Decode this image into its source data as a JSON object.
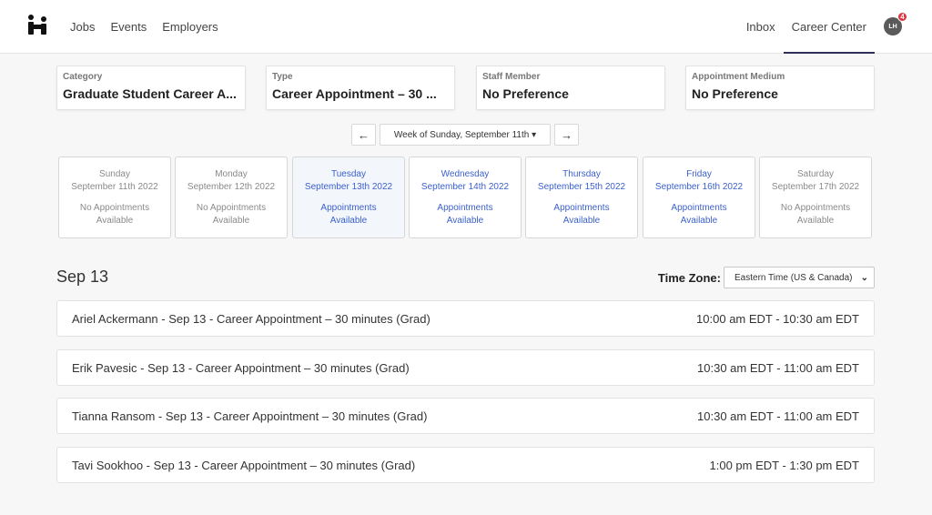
{
  "nav": {
    "logo_icon": "handshake-logo-icon",
    "left_links": [
      "Jobs",
      "Events",
      "Employers"
    ],
    "right_links": [
      "Inbox",
      "Career Center"
    ],
    "active_link": "Career Center",
    "avatar_initials": "LH",
    "notification_count": "4"
  },
  "filters": [
    {
      "label": "Category",
      "value": "Graduate Student Career A..."
    },
    {
      "label": "Type",
      "value": "Career Appointment – 30 ..."
    },
    {
      "label": "Staff Member",
      "value": "No Preference"
    },
    {
      "label": "Appointment Medium",
      "value": "No Preference"
    }
  ],
  "week_nav": {
    "prev_icon": "arrow-left-icon",
    "label": "Week of Sunday, September 11th ▾",
    "next_icon": "arrow-right-icon",
    "prev_glyph": "🡐",
    "next_glyph": "🡒"
  },
  "days": [
    {
      "weekday": "Sunday",
      "date": "September 11th 2022",
      "status1": "No Appointments",
      "status2": "Available",
      "available": false,
      "selected": false
    },
    {
      "weekday": "Monday",
      "date": "September 12th 2022",
      "status1": "No Appointments",
      "status2": "Available",
      "available": false,
      "selected": false
    },
    {
      "weekday": "Tuesday",
      "date": "September 13th 2022",
      "status1": "Appointments",
      "status2": "Available",
      "available": true,
      "selected": true
    },
    {
      "weekday": "Wednesday",
      "date": "September 14th 2022",
      "status1": "Appointments",
      "status2": "Available",
      "available": true,
      "selected": false
    },
    {
      "weekday": "Thursday",
      "date": "September 15th 2022",
      "status1": "Appointments",
      "status2": "Available",
      "available": true,
      "selected": false
    },
    {
      "weekday": "Friday",
      "date": "September 16th 2022",
      "status1": "Appointments",
      "status2": "Available",
      "available": true,
      "selected": false
    },
    {
      "weekday": "Saturday",
      "date": "September 17th 2022",
      "status1": "No Appointments",
      "status2": "Available",
      "available": false,
      "selected": false
    }
  ],
  "schedule": {
    "date_heading": "Sep 13",
    "timezone_label": "Time Zone:",
    "timezone_value": "Eastern Time (US & Canada)",
    "slots": [
      {
        "title": "Ariel Ackermann - Sep 13 - Career Appointment – 30 minutes (Grad)",
        "time": "10:00 am EDT - 10:30 am EDT"
      },
      {
        "title": "Erik Pavesic - Sep 13 - Career Appointment – 30 minutes (Grad)",
        "time": "10:30 am EDT - 11:00 am EDT"
      },
      {
        "title": "Tianna Ransom - Sep 13 - Career Appointment – 30 minutes (Grad)",
        "time": "10:30 am EDT - 11:00 am EDT"
      },
      {
        "title": "Tavi Sookhoo - Sep 13 - Career Appointment – 30 minutes (Grad)",
        "time": "1:00 pm EDT - 1:30 pm EDT"
      }
    ]
  },
  "colors": {
    "accent_blue": "#3a5fcd",
    "active_underline": "#2d2f5a",
    "badge_red": "#e0303b"
  }
}
